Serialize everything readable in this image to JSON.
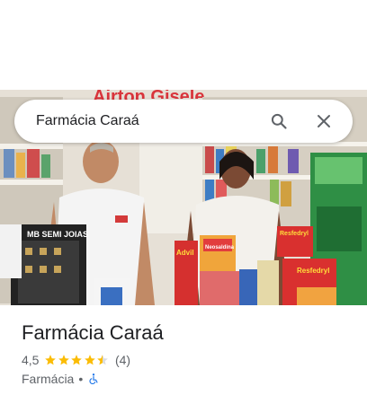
{
  "search": {
    "query": "Farmácia Caraá"
  },
  "photo": {
    "store_sign": "Airton Gisele",
    "product_labels": [
      "Advil",
      "Resfedryl",
      "Resfedryl",
      "Neosaldina"
    ],
    "display_box_text": "MB SEMI JOIAS"
  },
  "place": {
    "name": "Farmácia Caraá",
    "rating": "4,5",
    "rating_value": 4.5,
    "review_count": "(4)",
    "category": "Farmácia",
    "separator": "•"
  },
  "colors": {
    "star": "#fbbc04",
    "accessibility_icon": "#1a73e8",
    "text_primary": "#202124",
    "text_secondary": "#5f6368"
  },
  "icons": {
    "search": "search-icon",
    "close": "close-icon",
    "accessibility": "wheelchair-icon"
  }
}
